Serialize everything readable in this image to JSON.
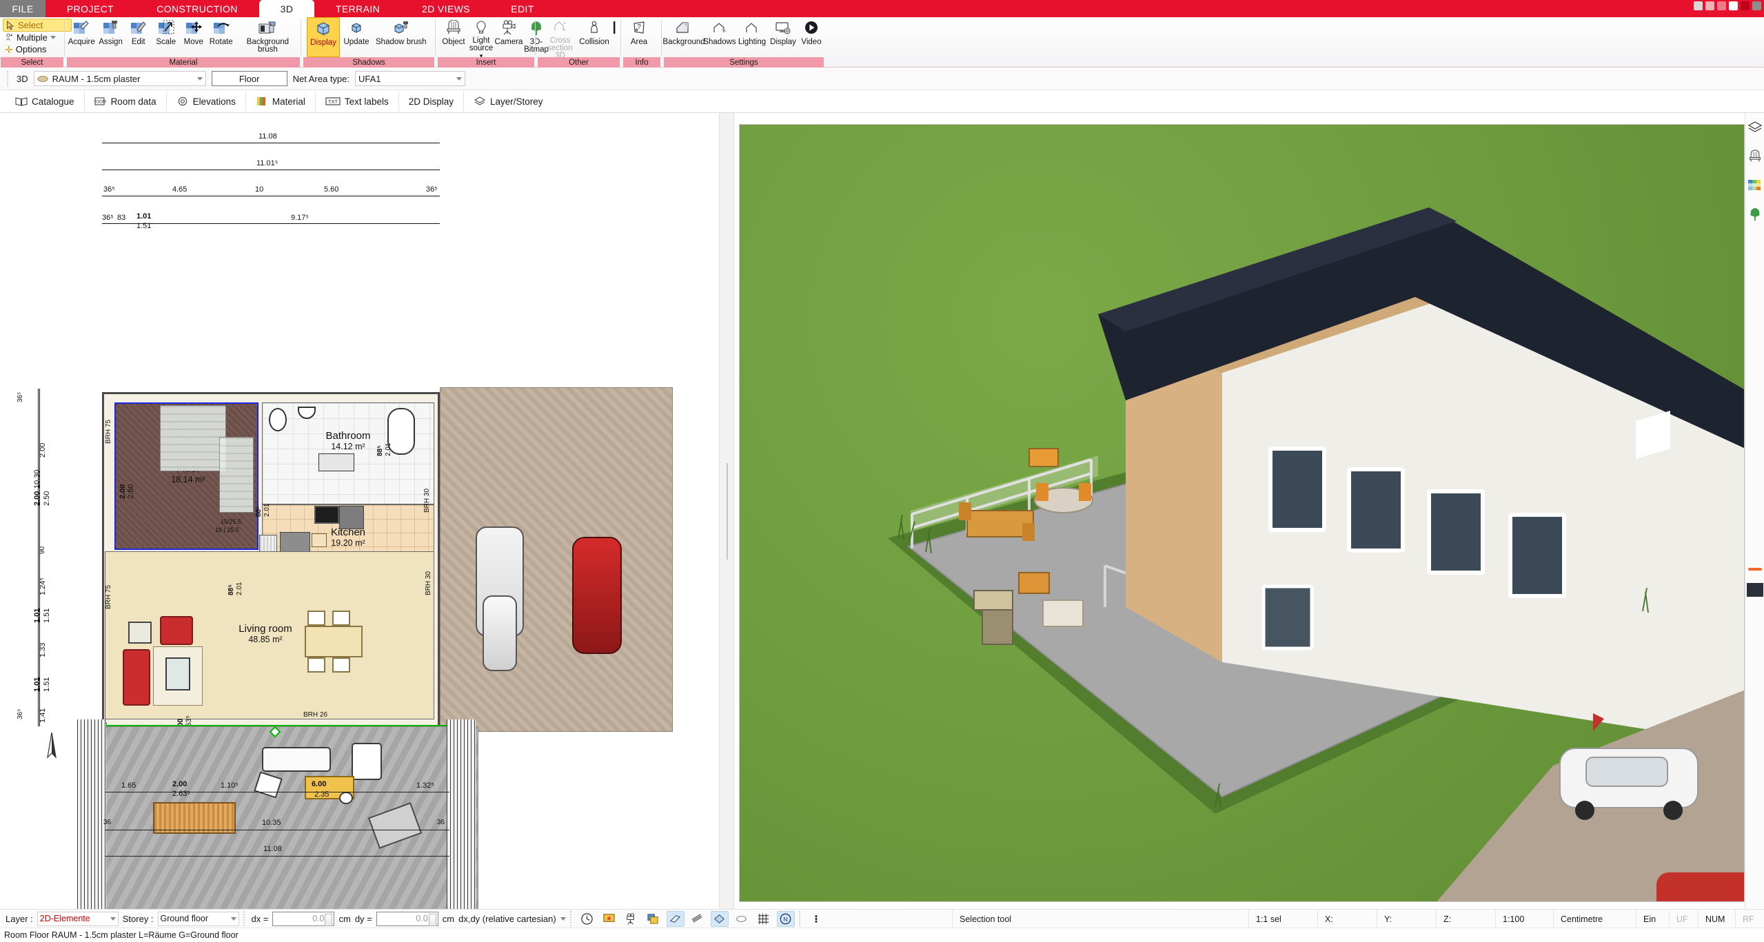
{
  "window": {
    "controls": [
      "minimize",
      "restore",
      "close",
      "help",
      "pin",
      "menu"
    ]
  },
  "ribbon": {
    "tabs": [
      {
        "id": "file",
        "label": "FILE",
        "active": false
      },
      {
        "id": "project",
        "label": "PROJECT",
        "active": false
      },
      {
        "id": "construction",
        "label": "CONSTRUCTION",
        "active": false
      },
      {
        "id": "3d",
        "label": "3D",
        "active": true
      },
      {
        "id": "terrain",
        "label": "TERRAIN",
        "active": false
      },
      {
        "id": "2dviews",
        "label": "2D VIEWS",
        "active": false
      },
      {
        "id": "edit",
        "label": "EDIT",
        "active": false
      }
    ],
    "groups": [
      {
        "id": "select",
        "caption": "Select",
        "select_label": "Select",
        "multiple_label": "Multiple",
        "options_label": "Options"
      },
      {
        "id": "material",
        "caption": "Material",
        "items": [
          {
            "id": "acquire",
            "label": "Acquire",
            "icon": "pipette-swatch-icon",
            "active": false
          },
          {
            "id": "assign",
            "label": "Assign",
            "icon": "brush-swatch-icon",
            "active": false
          },
          {
            "id": "edit",
            "label": "Edit",
            "icon": "pencil-swatch-icon",
            "active": false
          },
          {
            "id": "scale",
            "label": "Scale",
            "icon": "scale-arrow-icon",
            "active": false
          },
          {
            "id": "move",
            "label": "Move",
            "icon": "move-arrows-icon",
            "active": false
          },
          {
            "id": "rotate",
            "label": "Rotate",
            "icon": "rotate-arrow-icon",
            "active": false
          },
          {
            "id": "background-brush",
            "label": "Background brush",
            "icon": "background-brush-icon",
            "active": false
          }
        ]
      },
      {
        "id": "shadows",
        "caption": "Shadows",
        "items": [
          {
            "id": "display",
            "label": "Display",
            "icon": "cube-shadow-icon",
            "active": true
          },
          {
            "id": "update",
            "label": "Update",
            "icon": "cube-small-icon",
            "active": false
          },
          {
            "id": "shadow-brush",
            "label": "Shadow brush",
            "icon": "cube-brush-icon",
            "active": false
          }
        ]
      },
      {
        "id": "insert",
        "caption": "Insert",
        "items": [
          {
            "id": "object",
            "label": "Object",
            "icon": "chair-icon",
            "active": false
          },
          {
            "id": "light-source",
            "label": "Light source",
            "icon": "bulb-icon",
            "active": false,
            "dropdown": true
          },
          {
            "id": "camera",
            "label": "Camera",
            "icon": "camera-icon",
            "active": false
          },
          {
            "id": "3d-bitmap",
            "label": "3D-Bitmap",
            "icon": "tree-icon",
            "active": false
          }
        ]
      },
      {
        "id": "other",
        "caption": "Other",
        "items": [
          {
            "id": "cross-section-3d",
            "label": "Cross section 3D",
            "icon": "cross-section-icon",
            "active": false,
            "disabled": true
          },
          {
            "id": "collision",
            "label": "Collision",
            "icon": "person-icon",
            "active": false
          },
          {
            "id": "measure",
            "label": "",
            "icon": "ruler-line-icon",
            "active": false
          }
        ]
      },
      {
        "id": "info",
        "caption": "Info",
        "items": [
          {
            "id": "area",
            "label": "Area",
            "icon": "area-question-icon",
            "active": false
          }
        ]
      },
      {
        "id": "settings",
        "caption": "Settings",
        "items": [
          {
            "id": "background",
            "label": "Background",
            "icon": "house-background-icon",
            "active": false
          },
          {
            "id": "shadows",
            "label": "Shadows",
            "icon": "house-shadow-icon",
            "active": false
          },
          {
            "id": "lighting",
            "label": "Lighting",
            "icon": "house-light-icon",
            "active": false
          },
          {
            "id": "display",
            "label": "Display",
            "icon": "monitor-gear-icon",
            "active": false
          },
          {
            "id": "video",
            "label": "Video",
            "icon": "play-circle-icon",
            "active": false
          }
        ]
      }
    ]
  },
  "propbar": {
    "mode_label": "3D",
    "material_icon": "material-chip-icon",
    "material_value": "RAUM - 1.5cm plaster",
    "name_field_value": "Floor",
    "net_area_label": "Net Area type:",
    "net_area_value": "UFA1"
  },
  "tabstrip": {
    "tabs": [
      {
        "id": "catalogue",
        "label": "Catalogue",
        "icon": "book-icon"
      },
      {
        "id": "room-data",
        "label": "Room data",
        "icon": "room-icon"
      },
      {
        "id": "elevations",
        "label": "Elevations",
        "icon": "gear-outline-icon"
      },
      {
        "id": "material",
        "label": "Material",
        "icon": "color-swatch-icon"
      },
      {
        "id": "text-labels",
        "label": "Text labels",
        "icon": "txt-icon"
      },
      {
        "id": "2d-display",
        "label": "2D  Display",
        "icon": "2d-icon"
      },
      {
        "id": "layer-storey",
        "label": "Layer/Storey",
        "icon": "layers-icon"
      }
    ]
  },
  "plan": {
    "rooms": [
      {
        "id": "floor",
        "name": "Floor",
        "area": "18.14 m²",
        "selected": true
      },
      {
        "id": "bathroom",
        "name": "Bathroom",
        "area": "14.12 m²",
        "selected": false
      },
      {
        "id": "kitchen",
        "name": "Kitchen",
        "area": "19.20 m²",
        "selected": false
      },
      {
        "id": "living-room",
        "name": "Living room",
        "area": "48.85 m²",
        "selected": false
      }
    ],
    "top_dimensions": {
      "row1": [
        "11.08"
      ],
      "row2": [
        "11.01⁵"
      ],
      "row3": [
        "36⁵",
        "4.65",
        "10",
        "5.60",
        "36⁵"
      ],
      "row4": [
        "36⁵",
        "83",
        "1.01",
        "1.51",
        "9.17⁵"
      ]
    },
    "left_dimensions": {
      "outer": [
        "10.30"
      ],
      "chain": [
        "36⁵",
        "2.00",
        "2.00",
        "2.50",
        "90",
        "1.24⁵",
        "1.01",
        "1.51",
        "1.33",
        "1.01",
        "1.51",
        "1.41",
        "36⁵"
      ]
    },
    "terrace_dimensions": [
      "1.65",
      "2.00",
      "2.63⁵",
      "1.10⁵",
      "6.00",
      "2.35",
      "1.32⁵",
      "10.35",
      "11.08",
      "36",
      "36"
    ],
    "wall_marks": [
      "BRH 75",
      "BRH 75",
      "BRH 30",
      "BRH 26",
      "BRH 30",
      "2.00",
      "2.80",
      "88⁵",
      "2.01",
      "88⁵",
      "2.01",
      "88⁵",
      "2.01",
      "15/25.5",
      "16 | 25.5"
    ],
    "compass_label": "N"
  },
  "rail": {
    "buttons": [
      {
        "id": "layers",
        "icon": "layers-icon"
      },
      {
        "id": "objects",
        "icon": "chair-icon"
      },
      {
        "id": "materials",
        "icon": "color-swatch-icon"
      },
      {
        "id": "plants",
        "icon": "tree-icon"
      }
    ]
  },
  "statusbar": {
    "layer_label": "Layer :",
    "layer_value": "2D-Elemente",
    "storey_label": "Storey :",
    "storey_value": "Ground floor",
    "dx_label": "dx =",
    "dx_value": "0.0",
    "dx_unit": "cm",
    "dy_label": "dy =",
    "dy_value": "0.0",
    "dy_unit": "cm",
    "coord_mode": "dx,dy (relative cartesian)",
    "toggles": [
      {
        "id": "time",
        "icon": "clock-icon",
        "on": false
      },
      {
        "id": "presentation",
        "icon": "screen-star-icon",
        "on": false
      },
      {
        "id": "camera-path",
        "icon": "camera-icon",
        "on": false
      },
      {
        "id": "images",
        "icon": "images-icon",
        "on": false
      },
      {
        "id": "snap-surface",
        "icon": "plane-icon",
        "on": true
      },
      {
        "id": "snap-lines",
        "icon": "lines-icon",
        "on": false
      },
      {
        "id": "snap-plane",
        "icon": "diamond-plane-icon",
        "on": true
      },
      {
        "id": "snap-free",
        "icon": "cloud-icon",
        "on": false
      },
      {
        "id": "grid",
        "icon": "grid-icon",
        "on": false
      },
      {
        "id": "north",
        "icon": "north-icon",
        "on": true
      },
      {
        "id": "more",
        "icon": "dots-icon",
        "on": false
      }
    ],
    "right_cells": [
      {
        "id": "tool",
        "label": "Selection tool",
        "dim": false
      },
      {
        "id": "sel-scale",
        "label": "1:1 sel",
        "dim": false
      },
      {
        "id": "x",
        "label": "X:",
        "dim": false
      },
      {
        "id": "y",
        "label": "Y:",
        "dim": false
      },
      {
        "id": "z",
        "label": "Z:",
        "dim": false
      },
      {
        "id": "scale",
        "label": "1:100",
        "dim": false
      },
      {
        "id": "unit",
        "label": "Centimetre",
        "dim": false
      },
      {
        "id": "ein",
        "label": "Ein",
        "dim": false
      },
      {
        "id": "uf",
        "label": "UF",
        "dim": true
      },
      {
        "id": "num",
        "label": "NUM",
        "dim": false
      },
      {
        "id": "rf",
        "label": "RF",
        "dim": true
      }
    ]
  },
  "message": "Room Floor RAUM - 1.5cm plaster L=Räume G=Ground floor",
  "colors": {
    "ribbon_red": "#e8112d",
    "group_caption": "#f09aa9",
    "accent_yellow": "#ffd24d",
    "selection_blue": "#1a27e0",
    "selection_green": "#00b200",
    "grass_green": "#6f9b3e",
    "roof_dark": "#1e2330",
    "wall_wood": "#d8b183",
    "layer_red": "#cc0000"
  }
}
